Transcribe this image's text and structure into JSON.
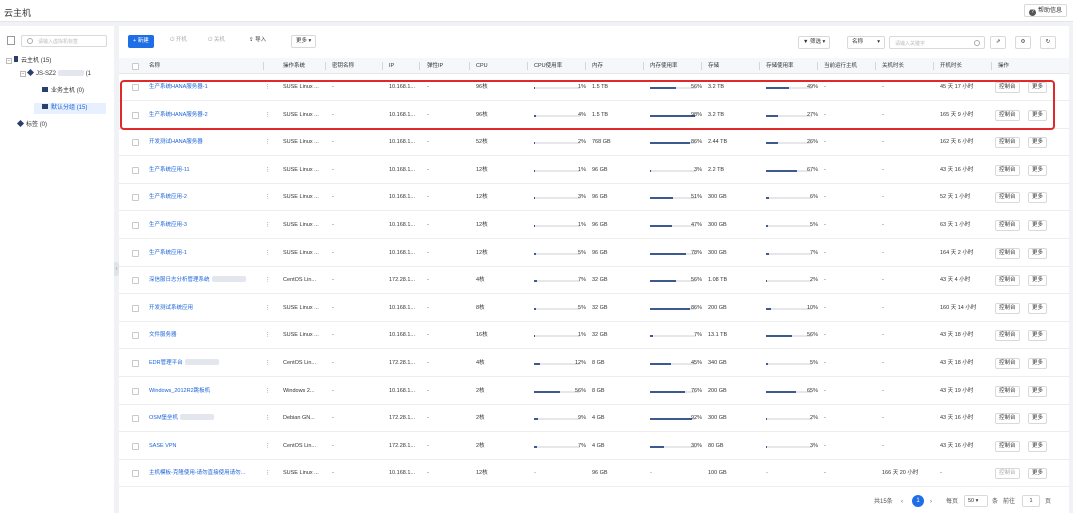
{
  "page": {
    "title": "云主机",
    "help_label": "帮助信息"
  },
  "sidebar": {
    "search_placeholder": "请输入虚拟机标签",
    "tree": [
      {
        "label": "云主机",
        "count": "(15)"
      },
      {
        "label": "JS-SZ2",
        "count": "(1"
      },
      {
        "label": "业务主机",
        "count": "(0)"
      },
      {
        "label": "默认分组",
        "count": "(15)"
      },
      {
        "label": "标签",
        "count": "(0)"
      }
    ]
  },
  "toolbar": {
    "create": "+ 新建",
    "power_on": "开机",
    "power_off": "关机",
    "import": "导入",
    "more": "更多",
    "filter": "筛选",
    "field": "名称",
    "search_placeholder": "请输入关键字"
  },
  "table": {
    "columns": {
      "name": "名称",
      "os": "操作系统",
      "key": "密钥名称",
      "ip": "IP",
      "eip": "弹性IP",
      "cpu": "CPU",
      "cpu_usage": "CPU使用率",
      "mem": "内存",
      "mem_usage": "内存使用率",
      "disk": "存储",
      "disk_usage": "存储使用率",
      "host": "当前运行主机",
      "down_time": "关机时长",
      "up_time": "开机时长",
      "actions": "操作"
    },
    "action_console": "控制台",
    "action_more": "更多",
    "rows": [
      {
        "name": "生产系统HANA服务器-1",
        "os": "SUSE Linux ...",
        "key": "-",
        "ip": "10.168.1...",
        "eip": "-",
        "cpu": "96核",
        "cpu_pct": 1,
        "cpu_label": "1%",
        "mem": "1.5 TB",
        "mem_pct": 56,
        "mem_label": "56%",
        "disk": "3.2 TB",
        "disk_pct": 49,
        "disk_label": "49%",
        "host": "-",
        "down": "-",
        "up": "45 天 17 小时",
        "console_disabled": false
      },
      {
        "name": "生产系统HANA服务器-2",
        "os": "SUSE Linux ...",
        "key": "-",
        "ip": "10.168.1...",
        "eip": "-",
        "cpu": "96核",
        "cpu_pct": 4,
        "cpu_label": "4%",
        "mem": "1.5 TB",
        "mem_pct": 98,
        "mem_label": "98%",
        "disk": "3.2 TB",
        "disk_pct": 27,
        "disk_label": "27%",
        "host": "-",
        "down": "-",
        "up": "165 天 9 小时",
        "console_disabled": false
      },
      {
        "name": "开发测试HANA服务器",
        "os": "SUSE Linux ...",
        "key": "-",
        "ip": "10.168.1...",
        "eip": "-",
        "cpu": "52核",
        "cpu_pct": 2,
        "cpu_label": "2%",
        "mem": "768 GB",
        "mem_pct": 86,
        "mem_label": "86%",
        "disk": "2.44 TB",
        "disk_pct": 26,
        "disk_label": "26%",
        "host": "-",
        "down": "-",
        "up": "162 天 6 小时",
        "console_disabled": false
      },
      {
        "name": "生产系统应用-11",
        "os": "SUSE Linux ...",
        "key": "-",
        "ip": "10.168.1...",
        "eip": "-",
        "cpu": "12核",
        "cpu_pct": 1,
        "cpu_label": "1%",
        "mem": "96 GB",
        "mem_pct": 3,
        "mem_label": "3%",
        "disk": "2.2 TB",
        "disk_pct": 67,
        "disk_label": "67%",
        "host": "-",
        "down": "-",
        "up": "43 天 16 小时",
        "console_disabled": false
      },
      {
        "name": "生产系统应用-2",
        "os": "SUSE Linux ...",
        "key": "-",
        "ip": "10.168.1...",
        "eip": "-",
        "cpu": "12核",
        "cpu_pct": 3,
        "cpu_label": "3%",
        "mem": "96 GB",
        "mem_pct": 51,
        "mem_label": "51%",
        "disk": "300 GB",
        "disk_pct": 6,
        "disk_label": "6%",
        "host": "-",
        "down": "-",
        "up": "52 天 1 小时",
        "console_disabled": false
      },
      {
        "name": "生产系统应用-3",
        "os": "SUSE Linux ...",
        "key": "-",
        "ip": "10.168.1...",
        "eip": "-",
        "cpu": "12核",
        "cpu_pct": 1,
        "cpu_label": "1%",
        "mem": "96 GB",
        "mem_pct": 47,
        "mem_label": "47%",
        "disk": "300 GB",
        "disk_pct": 5,
        "disk_label": "5%",
        "host": "-",
        "down": "-",
        "up": "63 天 1 小时",
        "console_disabled": false
      },
      {
        "name": "生产系统应用-1",
        "os": "SUSE Linux ...",
        "key": "-",
        "ip": "10.168.1...",
        "eip": "-",
        "cpu": "12核",
        "cpu_pct": 5,
        "cpu_label": "5%",
        "mem": "96 GB",
        "mem_pct": 78,
        "mem_label": "78%",
        "disk": "300 GB",
        "disk_pct": 7,
        "disk_label": "7%",
        "host": "-",
        "down": "-",
        "up": "164 天 2 小时",
        "console_disabled": false
      },
      {
        "name": "深信服日志分析管理系统",
        "os": "CentOS Lin...",
        "key": "-",
        "ip": "172.28.1...",
        "eip": "-",
        "cpu": "4核",
        "cpu_pct": 7,
        "cpu_label": "7%",
        "mem": "32 GB",
        "mem_pct": 56,
        "mem_label": "56%",
        "disk": "1.08 TB",
        "disk_pct": 2,
        "disk_label": "2%",
        "host": "-",
        "down": "-",
        "up": "43 天 4 小时",
        "console_disabled": false,
        "blurred": true
      },
      {
        "name": "开发测试系统应用",
        "os": "SUSE Linux ...",
        "key": "-",
        "ip": "10.168.1...",
        "eip": "-",
        "cpu": "8核",
        "cpu_pct": 5,
        "cpu_label": "5%",
        "mem": "32 GB",
        "mem_pct": 86,
        "mem_label": "86%",
        "disk": "200 GB",
        "disk_pct": 10,
        "disk_label": "10%",
        "host": "-",
        "down": "-",
        "up": "160 天 14 小时",
        "console_disabled": false
      },
      {
        "name": "文件服务器",
        "os": "SUSE Linux ...",
        "key": "-",
        "ip": "10.168.1...",
        "eip": "-",
        "cpu": "16核",
        "cpu_pct": 1,
        "cpu_label": "1%",
        "mem": "32 GB",
        "mem_pct": 7,
        "mem_label": "7%",
        "disk": "13.1 TB",
        "disk_pct": 56,
        "disk_label": "56%",
        "host": "-",
        "down": "-",
        "up": "43 天 18 小时",
        "console_disabled": false
      },
      {
        "name": "EDR管理平台",
        "os": "CentOS Lin...",
        "key": "-",
        "ip": "172.28.1...",
        "eip": "-",
        "cpu": "4核",
        "cpu_pct": 12,
        "cpu_label": "12%",
        "mem": "8 GB",
        "mem_pct": 45,
        "mem_label": "45%",
        "disk": "340 GB",
        "disk_pct": 5,
        "disk_label": "5%",
        "host": "-",
        "down": "-",
        "up": "43 天 18 小时",
        "console_disabled": false,
        "blurred": true
      },
      {
        "name": "Windows_2012R2跳板机",
        "os": "Windows 2...",
        "key": "-",
        "ip": "10.168.1...",
        "eip": "-",
        "cpu": "2核",
        "cpu_pct": 56,
        "cpu_label": "56%",
        "mem": "8 GB",
        "mem_pct": 76,
        "mem_label": "76%",
        "disk": "200 GB",
        "disk_pct": 65,
        "disk_label": "65%",
        "host": "-",
        "down": "-",
        "up": "43 天 19 小时",
        "console_disabled": false
      },
      {
        "name": "OSM堡垒机",
        "os": "Debian GN...",
        "key": "-",
        "ip": "172.28.1...",
        "eip": "-",
        "cpu": "2核",
        "cpu_pct": 9,
        "cpu_label": "9%",
        "mem": "4 GB",
        "mem_pct": 92,
        "mem_label": "92%",
        "disk": "300 GB",
        "disk_pct": 2,
        "disk_label": "2%",
        "host": "-",
        "down": "-",
        "up": "43 天 16 小时",
        "console_disabled": false,
        "blurred": true
      },
      {
        "name": "SASE VPN",
        "os": "CentOS Lin...",
        "key": "-",
        "ip": "172.28.1...",
        "eip": "-",
        "cpu": "2核",
        "cpu_pct": 7,
        "cpu_label": "7%",
        "mem": "4 GB",
        "mem_pct": 30,
        "mem_label": "30%",
        "disk": "80 GB",
        "disk_pct": 3,
        "disk_label": "3%",
        "host": "-",
        "down": "-",
        "up": "43 天 16 小时",
        "console_disabled": false
      },
      {
        "name": "主机模板-克隆使用-请勿直接使用请勿...",
        "os": "SUSE Linux ...",
        "key": "-",
        "ip": "10.168.1...",
        "eip": "-",
        "cpu": "12核",
        "cpu_pct": null,
        "cpu_label": "-",
        "mem": "96 GB",
        "mem_pct": null,
        "mem_label": "-",
        "disk": "100 GB",
        "disk_pct": null,
        "disk_label": "-",
        "host": "-",
        "down": "166 天 20 小时",
        "up": "-",
        "console_disabled": true
      }
    ]
  },
  "pagination": {
    "total": "共15条",
    "current": "1",
    "per_page_label": "每页",
    "per_page": "50",
    "unit": "条",
    "goto_label": "前往",
    "goto_value": "1",
    "page_unit": "页"
  }
}
